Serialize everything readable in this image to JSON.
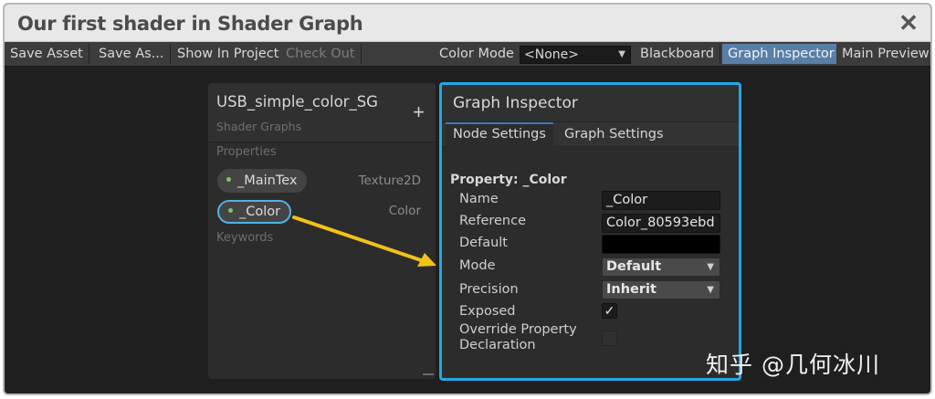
{
  "window": {
    "title": "Our first shader in Shader Graph",
    "close_glyph": "✕"
  },
  "toolbar": {
    "save_asset": "Save Asset",
    "save_as": "Save As...",
    "show_in_project": "Show In Project",
    "check_out": "Check Out",
    "color_mode_label": "Color Mode",
    "color_mode_value": "<None>",
    "blackboard": "Blackboard",
    "graph_inspector": "Graph Inspector",
    "main_preview": "Main Preview"
  },
  "blackboard": {
    "title": "USB_simple_color_SG",
    "subtitle": "Shader Graphs",
    "add_glyph": "+",
    "properties_label": "Properties",
    "keywords_label": "Keywords",
    "properties": [
      {
        "name": "_MainTex",
        "type": "Texture2D"
      },
      {
        "name": "_Color",
        "type": "Color"
      }
    ]
  },
  "inspector": {
    "title": "Graph Inspector",
    "tabs": [
      "Node Settings",
      "Graph Settings"
    ],
    "heading": "Property: _Color",
    "labels": {
      "name": "Name",
      "reference": "Reference",
      "default": "Default",
      "mode": "Mode",
      "precision": "Precision",
      "exposed": "Exposed",
      "override": "Override Property Declaration"
    },
    "values": {
      "name": "_Color",
      "reference": "Color_80593ebd",
      "default_color": "#000000",
      "mode": "Default",
      "precision": "Inherit",
      "exposed_check": "✓"
    }
  },
  "colors": {
    "highlight_outline": "#22a7e6",
    "annotation_arrow": "#f2c21b",
    "active_toolbar": "#5a7fa6"
  },
  "watermark": "知乎 @几何冰川"
}
